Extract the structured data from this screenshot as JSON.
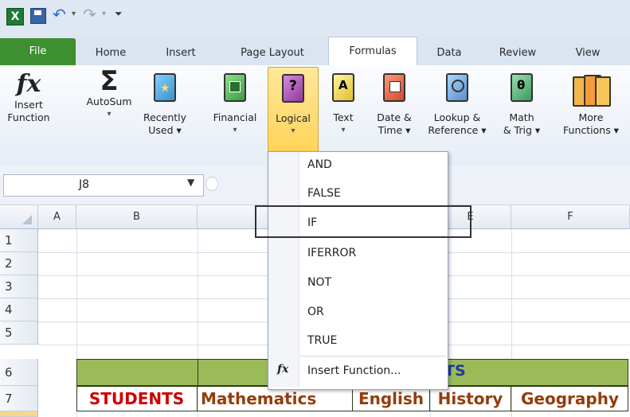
{
  "app": {
    "title": "Microsoft Excel"
  },
  "qat": {
    "undo_sep": "▾",
    "redo_sep": "▾",
    "customize": "⏷"
  },
  "tabs": [
    {
      "label": "File"
    },
    {
      "label": "Home"
    },
    {
      "label": "Insert"
    },
    {
      "label": "Page Layout"
    },
    {
      "label": "Formulas"
    },
    {
      "label": "Data"
    },
    {
      "label": "Review"
    },
    {
      "label": "View"
    }
  ],
  "ribbon": {
    "insert_function": {
      "line1": "Insert",
      "line2": "Function"
    },
    "autosum": {
      "line1": "AutoSum",
      "line2": "▾"
    },
    "recently_used": {
      "line1": "Recently",
      "line2": "Used ▾"
    },
    "financial": {
      "line1": "Financial",
      "line2": "▾"
    },
    "logical": {
      "line1": "Logical",
      "line2": "▾"
    },
    "text": {
      "line1": "Text",
      "line2": "▾"
    },
    "date_time": {
      "line1": "Date &",
      "line2": "Time ▾"
    },
    "lookup": {
      "line1": "Lookup &",
      "line2": "Reference ▾"
    },
    "math": {
      "line1": "Math",
      "line2": "& Trig ▾"
    },
    "more": {
      "line1": "More",
      "line2": "Functions ▾"
    }
  },
  "formula_bar": {
    "name_box": "J8"
  },
  "columns": [
    "A",
    "B",
    "E",
    "F"
  ],
  "rows": [
    "1",
    "2",
    "3",
    "4",
    "5",
    "6",
    "7"
  ],
  "cells": {
    "row6_title_fragment": "TS",
    "students": "STUDENTS",
    "mathematics": "Mathematics",
    "english": "English",
    "history": "History",
    "geography": "Geography"
  },
  "logical_menu": {
    "items": [
      "AND",
      "FALSE",
      "IF",
      "IFERROR",
      "NOT",
      "OR",
      "TRUE"
    ],
    "insert_function": "Insert Function..."
  },
  "colors": {
    "file_tab": "#3d8f2f",
    "green_header": "#9bbb59",
    "red_text": "#cc0000",
    "brown_text": "#943c0c"
  }
}
